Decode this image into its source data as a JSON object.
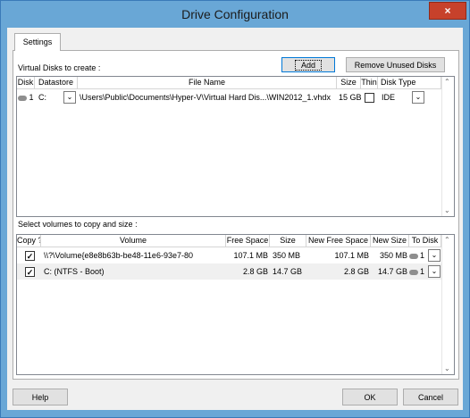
{
  "window": {
    "title": "Drive Configuration",
    "close_glyph": "×"
  },
  "tabs": [
    {
      "label": "Settings"
    }
  ],
  "virtual_disks": {
    "section_label": "Virtual Disks to create :",
    "add_label": "Add",
    "remove_unused_label": "Remove Unused Disks",
    "columns": {
      "disk": "Disk",
      "datastore": "Datastore",
      "file_name": "File Name",
      "size": "Size",
      "thin": "Thin",
      "disk_type": "Disk Type"
    },
    "rows": [
      {
        "disk": "1",
        "datastore": "C:",
        "file_name": "\\Users\\Public\\Documents\\Hyper-V\\Virtual  Hard  Dis...\\WIN2012_1.vhdx",
        "size": "15 GB",
        "thin": false,
        "disk_type": "IDE"
      }
    ]
  },
  "volumes": {
    "section_label": "Select volumes to copy and size :",
    "columns": {
      "copy": "Copy ?",
      "volume": "Volume",
      "free_space": "Free Space",
      "size": "Size",
      "new_free_space": "New Free Space",
      "new_size": "New Size",
      "to_disk": "To Disk"
    },
    "rows": [
      {
        "copy": true,
        "volume": "\\\\?\\Volume{e8e8b63b-be48-11e6-93e7-80",
        "free_space": "107.1 MB",
        "size": "350 MB",
        "new_free_space": "107.1 MB",
        "new_size": "350 MB",
        "to_disk": "1"
      },
      {
        "copy": true,
        "volume": "C: (NTFS - Boot)",
        "free_space": "2.8 GB",
        "size": "14.7 GB",
        "new_free_space": "2.8 GB",
        "new_size": "14.7 GB",
        "to_disk": "1"
      }
    ]
  },
  "footer": {
    "help_label": "Help",
    "ok_label": "OK",
    "cancel_label": "Cancel"
  },
  "colors": {
    "titlebar": "#69a7d6",
    "close": "#c7412b"
  }
}
